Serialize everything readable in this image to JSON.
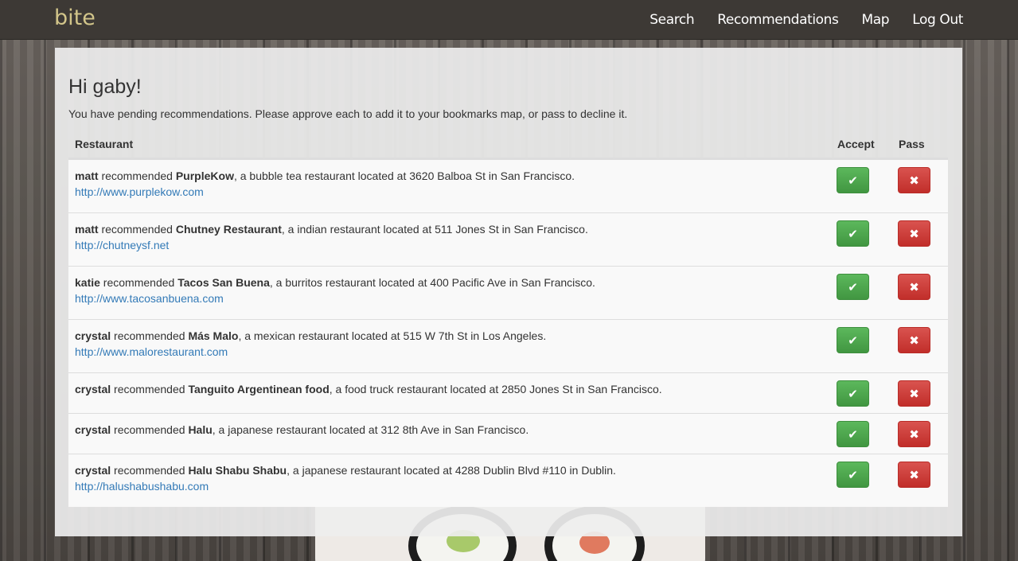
{
  "nav": {
    "brand": "bite",
    "links": [
      "Search",
      "Recommendations",
      "Map",
      "Log Out"
    ]
  },
  "page": {
    "greeting": "Hi gaby!",
    "intro": "You have pending recommendations. Please approve each to add it to your bookmarks map, or pass to decline it."
  },
  "table": {
    "headers": {
      "restaurant": "Restaurant",
      "accept": "Accept",
      "pass": "Pass"
    },
    "rows": [
      {
        "user": "matt",
        "verb": " recommended ",
        "restaurant": "PurpleKow",
        "detail": ", a bubble tea restaurant located at 3620 Balboa St in San Francisco.",
        "url": "http://www.purplekow.com"
      },
      {
        "user": "matt",
        "verb": " recommended ",
        "restaurant": "Chutney Restaurant",
        "detail": ", a indian restaurant located at 511 Jones St in San Francisco.",
        "url": "http://chutneysf.net"
      },
      {
        "user": "katie",
        "verb": " recommended ",
        "restaurant": "Tacos San Buena",
        "detail": ", a burritos restaurant located at 400 Pacific Ave in San Francisco.",
        "url": "http://www.tacosanbuena.com"
      },
      {
        "user": "crystal",
        "verb": " recommended ",
        "restaurant": "Más Malo",
        "detail": ", a mexican restaurant located at 515 W 7th St in Los Angeles.",
        "url": "http://www.malorestaurant.com"
      },
      {
        "user": "crystal",
        "verb": " recommended ",
        "restaurant": "Tanguito Argentinean food",
        "detail": ", a food truck restaurant located at 2850 Jones St in San Francisco.",
        "url": ""
      },
      {
        "user": "crystal",
        "verb": " recommended ",
        "restaurant": "Halu",
        "detail": ", a japanese restaurant located at 312 8th Ave in San Francisco.",
        "url": ""
      },
      {
        "user": "crystal",
        "verb": " recommended ",
        "restaurant": "Halu Shabu Shabu",
        "detail": ", a japanese restaurant located at 4288 Dublin Blvd #110 in Dublin.",
        "url": "http://halushabushabu.com"
      }
    ]
  },
  "icons": {
    "accept": "check-icon",
    "pass": "close-icon"
  },
  "colors": {
    "nav_bg": "#3d3935",
    "brand": "#d2c58a",
    "accept": "#5cb85c",
    "pass": "#d9534f",
    "link": "#337ab7"
  }
}
